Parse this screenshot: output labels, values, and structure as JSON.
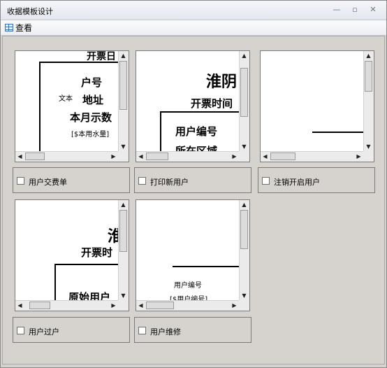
{
  "window": {
    "title": "收据模板设计"
  },
  "toolbar": {
    "view_label": "查看"
  },
  "templates": [
    {
      "id": "payment",
      "checkbox_label": "用户交费单",
      "texts": {
        "t1": "开票日",
        "t2": "户号",
        "t3": "文本",
        "t4": "地址",
        "t5": "本月示数",
        "t6": "[$本用水量]"
      }
    },
    {
      "id": "new-user",
      "checkbox_label": "打印新用户",
      "texts": {
        "t1": "淮阴",
        "t2": "开票时间",
        "t3": "用户编号",
        "t4": "所在区域"
      }
    },
    {
      "id": "cancel-user",
      "checkbox_label": "注销开启用户",
      "texts": {}
    },
    {
      "id": "transfer",
      "checkbox_label": "用户过户",
      "texts": {
        "t1": "淮",
        "t2": "开票时",
        "t3": "原始用户"
      }
    },
    {
      "id": "repair",
      "checkbox_label": "用户维修",
      "texts": {
        "t1": "用户编号",
        "t2": "[$用户编号]"
      }
    }
  ]
}
